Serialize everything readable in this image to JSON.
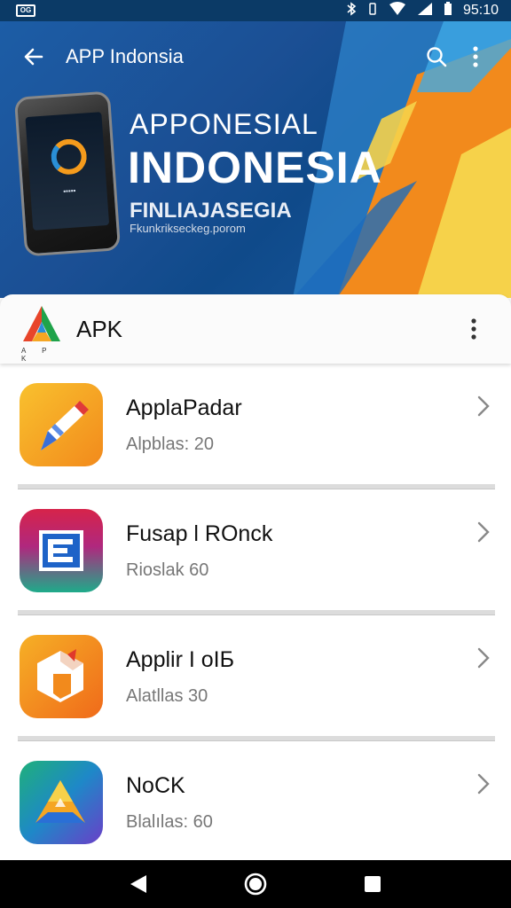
{
  "status_bar": {
    "left_icon": "screen-cast-icon",
    "left_label": "OG",
    "time": "95:10",
    "icons": [
      "bluetooth-icon",
      "vibrate-icon",
      "wifi-icon",
      "signal-icon",
      "battery-icon"
    ]
  },
  "app_bar": {
    "title": "APP Indonsia",
    "back_icon": "back-arrow-icon",
    "search_icon": "search-icon",
    "more_icon": "more-vert-icon"
  },
  "hero": {
    "title_small": "APPONESIAL",
    "title_big": "INDONESIA",
    "subtitle": "FINLIAJASEGIA",
    "url": "Fkunkrikseckeg.porom",
    "phone_text": "▪▪▪▪▪",
    "colors": {
      "blue": "#1b5aa0",
      "orange": "#f28a1c",
      "yellow": "#f6d24a",
      "light_blue": "#3fa9e6"
    }
  },
  "card": {
    "title": "APK",
    "logo_letters": "A P K",
    "logo_icon": "apk-logo-icon",
    "more_icon": "more-vert-icon"
  },
  "apps": [
    {
      "name": "ApplaPadar",
      "sub": "Alpblas: 20",
      "icon": "pencil-app-icon"
    },
    {
      "name": "Fusap l ROnck",
      "sub": "Rioslak 60",
      "icon": "letter-e-app-icon"
    },
    {
      "name": "Applir I oIБ",
      "sub": "Alatllas 30",
      "icon": "hexagon-app-icon"
    },
    {
      "name": "NoCK",
      "sub": "Blalılas: 60",
      "icon": "triangle-app-icon"
    }
  ],
  "nav": {
    "back": "nav-back-icon",
    "home": "nav-home-icon",
    "recents": "nav-recents-icon"
  }
}
